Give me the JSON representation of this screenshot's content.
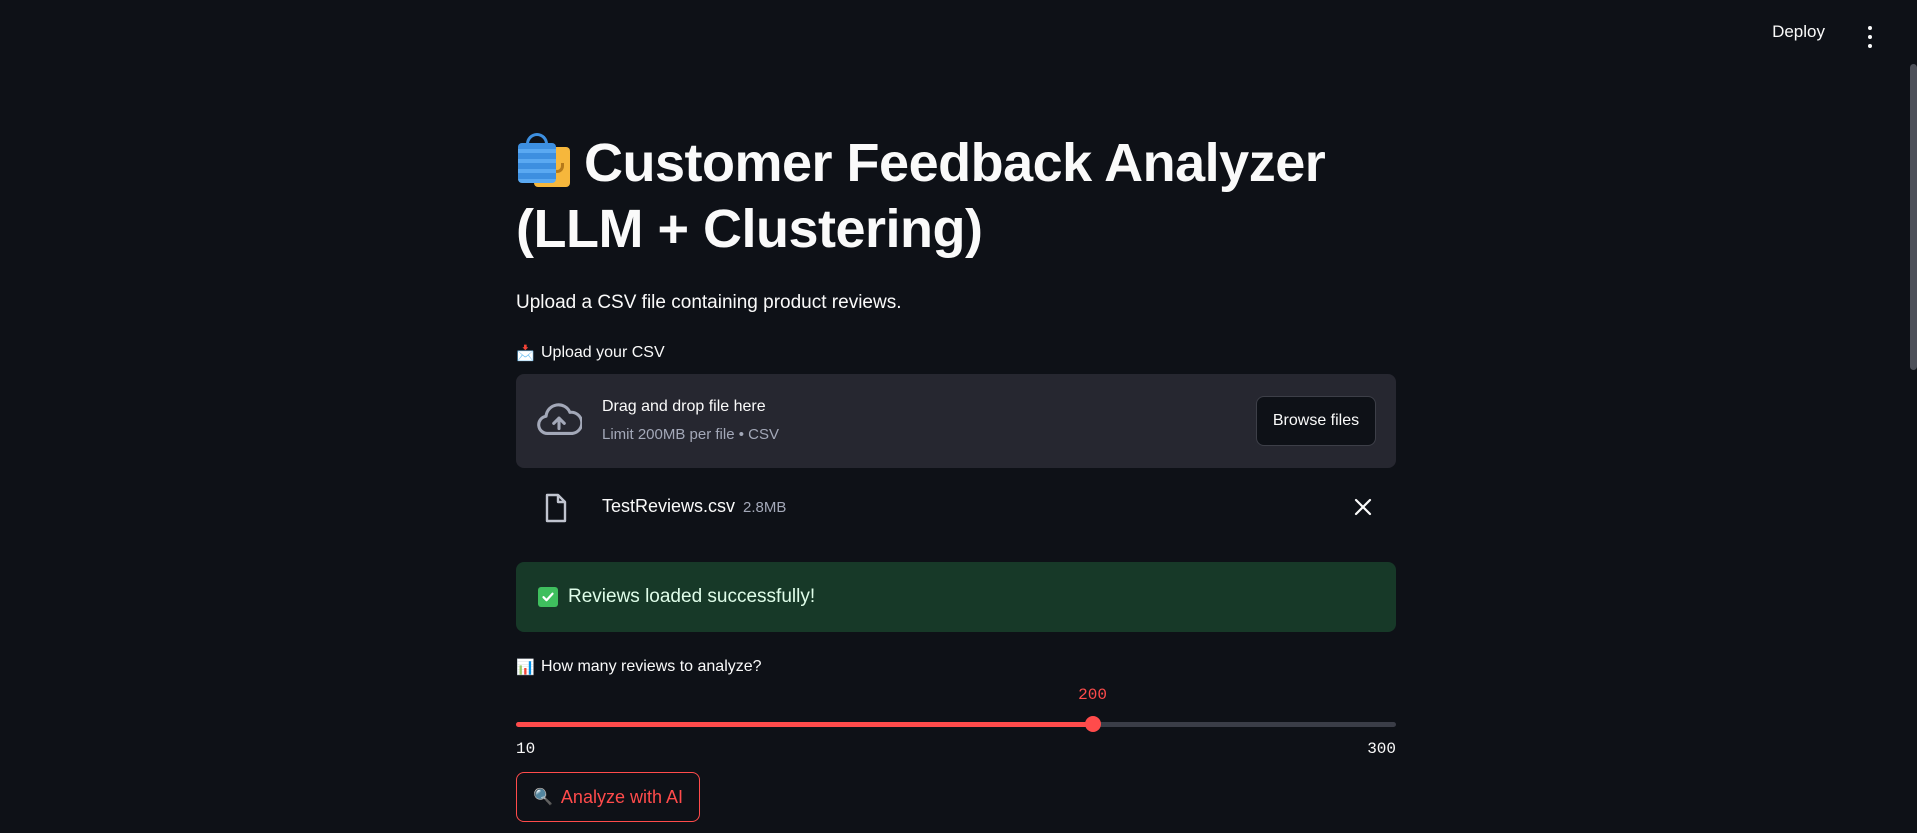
{
  "header": {
    "deploy_label": "Deploy",
    "menu_icon": "kebab-menu-icon"
  },
  "page": {
    "title": "Customer Feedback Analyzer (LLM + Clustering)",
    "title_icon": "shopping-bags-icon",
    "subtitle": "Upload a CSV file containing product reviews."
  },
  "uploader": {
    "label_emoji": "📩",
    "label": "Upload your CSV",
    "drop_title": "Drag and drop file here",
    "drop_limit": "Limit 200MB per file • CSV",
    "browse_label": "Browse files",
    "file": {
      "name": "TestReviews.csv",
      "size": "2.8MB"
    }
  },
  "alert": {
    "text": "Reviews loaded successfully!",
    "type": "success",
    "color": "#173928"
  },
  "slider": {
    "label_emoji": "📊",
    "label": "How many reviews to analyze?",
    "min": 10,
    "max": 300,
    "value": 200,
    "min_label": "10",
    "max_label": "300",
    "value_label": "200",
    "accent": "#ff4b4b"
  },
  "actions": {
    "analyze_emoji": "🔍",
    "analyze_label": "Analyze with AI"
  }
}
